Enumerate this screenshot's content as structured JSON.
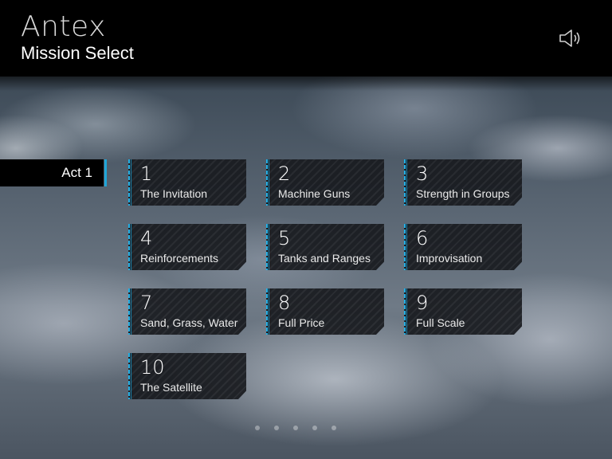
{
  "header": {
    "app_title": "Antex",
    "screen_title": "Mission Select",
    "sound_icon": "speaker-icon"
  },
  "act": {
    "label": "Act 1"
  },
  "missions": [
    {
      "number": "1",
      "name": "The Invitation"
    },
    {
      "number": "2",
      "name": "Machine Guns"
    },
    {
      "number": "3",
      "name": "Strength in Groups"
    },
    {
      "number": "4",
      "name": "Reinforcements"
    },
    {
      "number": "5",
      "name": "Tanks and Ranges"
    },
    {
      "number": "6",
      "name": "Improvisation"
    },
    {
      "number": "7",
      "name": "Sand, Grass, Water"
    },
    {
      "number": "8",
      "name": "Full Price"
    },
    {
      "number": "9",
      "name": "Full Scale"
    },
    {
      "number": "10",
      "name": "The Satellite"
    }
  ],
  "colors": {
    "accent": "#22b0e6",
    "header_bg": "#000000",
    "tile_bg": "#181a1e"
  }
}
